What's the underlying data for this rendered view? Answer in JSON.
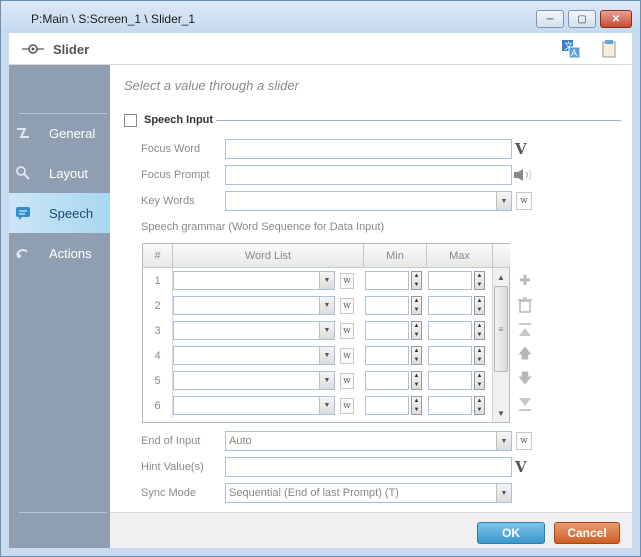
{
  "window": {
    "title": "P:Main \\ S:Screen_1 \\ Slider_1"
  },
  "header": {
    "app_name": "Slider"
  },
  "sidebar": {
    "items": [
      {
        "label": "General",
        "icon": "general-icon"
      },
      {
        "label": "Layout",
        "icon": "layout-icon"
      },
      {
        "label": "Speech",
        "icon": "speech-icon",
        "active": true
      },
      {
        "label": "Actions",
        "icon": "actions-icon"
      }
    ]
  },
  "main": {
    "subtitle": "Select a value through a slider",
    "section_title": "Speech Input",
    "focus_word": {
      "label": "Focus Word",
      "value": ""
    },
    "focus_prompt": {
      "label": "Focus Prompt",
      "value": ""
    },
    "key_words": {
      "label": "Key Words",
      "value": ""
    },
    "grammar_label": "Speech grammar (Word Sequence for Data Input)",
    "grid": {
      "headers": [
        "#",
        "Word List",
        "Min",
        "Max"
      ],
      "rows": [
        "1",
        "2",
        "3",
        "4",
        "5",
        "6"
      ]
    },
    "end_of_input": {
      "label": "End of Input",
      "value": "Auto"
    },
    "hint_value": {
      "label": "Hint Value(s)",
      "value": ""
    },
    "sync_mode": {
      "label": "Sync Mode",
      "value": "Sequential (End of last Prompt) (T)"
    },
    "w_button": "w",
    "v_button": "V"
  },
  "footer": {
    "ok": "OK",
    "cancel": "Cancel"
  },
  "colors": {
    "accent": "#3a97ce",
    "cancel": "#cd5e25",
    "sidebar": "#8f9fb1"
  }
}
